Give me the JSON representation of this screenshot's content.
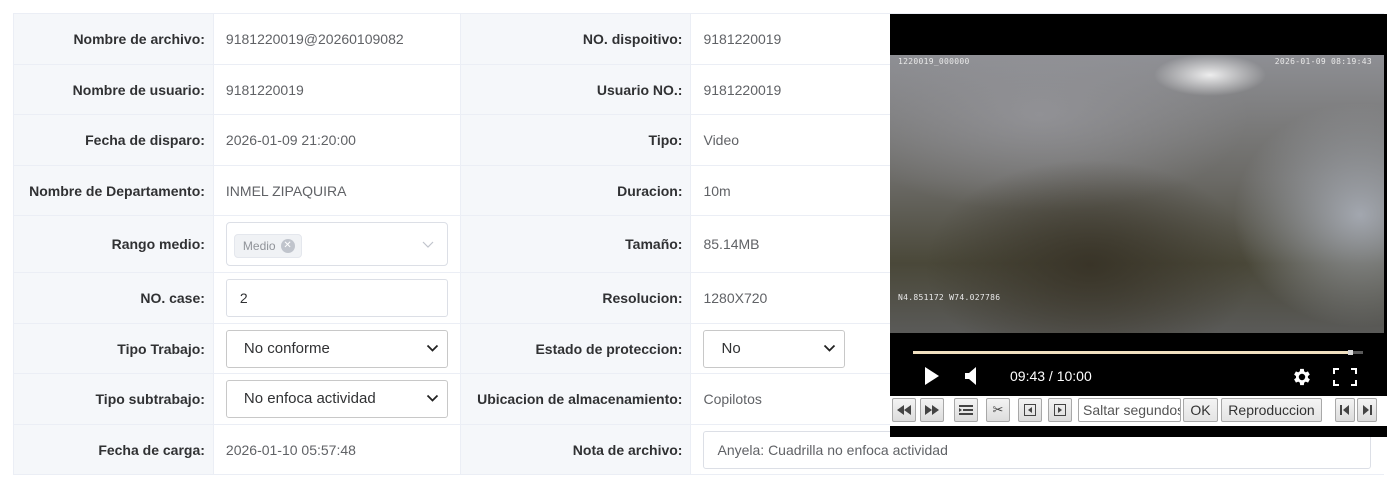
{
  "rows": [
    {
      "l1": "Nombre de archivo:",
      "v1": "9181220019@20260109082",
      "l2": "NO. dispoitivo:",
      "v2": "9181220019"
    },
    {
      "l1": "Nombre de usuario:",
      "v1": "9181220019",
      "l2": "Usuario NO.:",
      "v2": "9181220019"
    },
    {
      "l1": "Fecha de disparo:",
      "v1": "2026-01-09 21:20:00",
      "l2": "Tipo:",
      "v2": "Video"
    },
    {
      "l1": "Nombre de Departamento:",
      "v1": "INMEL ZIPAQUIRA",
      "l2": "Duracion:",
      "v2": "10m"
    },
    {
      "l1": "Rango medio:",
      "v1_tag": "Medio",
      "l2": "Tamaño:",
      "v2": "85.14MB"
    },
    {
      "l1": "NO. case:",
      "v1": "2",
      "l2": "Resolucion:",
      "v2": "1280X720"
    },
    {
      "l1": "Tipo Trabajo:",
      "v1": "No conforme",
      "l2": "Estado de proteccion:",
      "v2": "No"
    },
    {
      "l1": "Tipo subtrabajo:",
      "v1": "No enfoca actividad",
      "l2": "Ubicacion de almacenamiento:",
      "v2": "Copilotos"
    },
    {
      "l1": "Fecha de carga:",
      "v1": "2026-01-10 05:57:48",
      "l2": "Nota de archivo:",
      "v2": "Anyela: Cuadrilla no enfoca actividad"
    }
  ],
  "player": {
    "osd_top_left": "1220019_000000",
    "osd_top_right": "2026-01-09 08:19:43",
    "osd_gps": "N4.851172  W74.027786",
    "time": "09:43 / 10:00",
    "progress": 0.971,
    "seek_placeholder": "Saltar segundos",
    "ok_label": "OK",
    "playback_label": "Reproduccion"
  }
}
